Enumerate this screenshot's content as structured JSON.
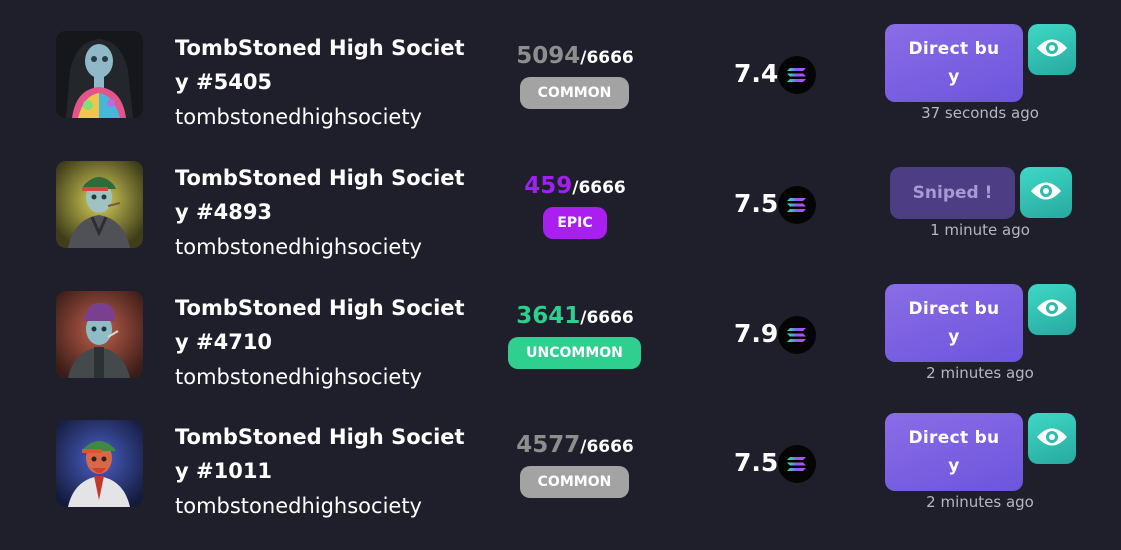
{
  "listings": [
    {
      "name": "TombStoned High Society #5405",
      "name_line1": "TombStoned High Societ",
      "name_line2": "y #5405",
      "collection": "tombstonedhighsociety",
      "rank": "5094",
      "rank_total": "/6666",
      "rarity": "COMMON",
      "rarity_color": "#a3a3a3",
      "rank_color": "#8e8e8e",
      "price": "7.4",
      "action": "Direct buy",
      "action_line1": "Direct bu",
      "action_line2": "y",
      "action_state": "active",
      "time_ago": "37 seconds ago"
    },
    {
      "name": "TombStoned High Society #4893",
      "name_line1": "TombStoned High Societ",
      "name_line2": "y #4893",
      "collection": "tombstonedhighsociety",
      "rank": "459",
      "rank_total": "/6666",
      "rarity": "EPIC",
      "rarity_color": "#a81ff0",
      "rank_color": "#a020f0",
      "price": "7.5",
      "action": "Sniped !",
      "action_state": "sniped",
      "time_ago": "1 minute ago"
    },
    {
      "name": "TombStoned High Society #4710",
      "name_line1": "TombStoned High Societ",
      "name_line2": "y #4710",
      "collection": "tombstonedhighsociety",
      "rank": "3641",
      "rank_total": "/6666",
      "rarity": "UNCOMMON",
      "rarity_color": "#2fcf8f",
      "rank_color": "#2fcf8f",
      "price": "7.9",
      "action": "Direct buy",
      "action_line1": "Direct bu",
      "action_line2": "y",
      "action_state": "active",
      "time_ago": "2 minutes ago"
    },
    {
      "name": "TombStoned High Society #1011",
      "name_line1": "TombStoned High Societ",
      "name_line2": "y #1011",
      "collection": "tombstonedhighsociety",
      "rank": "4577",
      "rank_total": "/6666",
      "rarity": "COMMON",
      "rarity_color": "#a3a3a3",
      "rank_color": "#8e8e8e",
      "price": "7.5",
      "action": "Direct buy",
      "action_line1": "Direct bu",
      "action_line2": "y",
      "action_state": "active",
      "time_ago": "2 minutes ago"
    }
  ],
  "icons": {
    "currency": "solana-icon",
    "view": "eye-icon"
  },
  "colors": {
    "background": "#1f1f2c",
    "buy_button": "#7b62e2",
    "sniped_button": "#4c3d84",
    "view_button": "#33c4b6",
    "epic": "#a81ff0",
    "uncommon": "#2fcf8f",
    "common": "#a3a3a3"
  }
}
